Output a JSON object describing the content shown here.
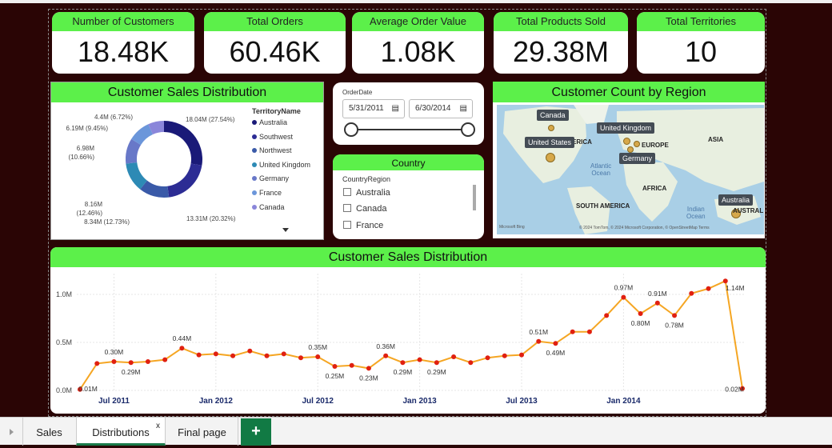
{
  "kpis": [
    {
      "title": "Number of Customers",
      "value": "18.48K"
    },
    {
      "title": "Total Orders",
      "value": "60.46K"
    },
    {
      "title": "Average Order Value",
      "value": "1.08K"
    },
    {
      "title": "Total Products Sold",
      "value": "29.38M"
    },
    {
      "title": "Total Territories",
      "value": "10"
    }
  ],
  "donut": {
    "title": "Customer Sales Distribution",
    "legend_title": "TerritoryName",
    "slices": [
      {
        "name": "Australia",
        "value": 18.04,
        "label": "18.04M (27.54%)",
        "color": "#1a1a78"
      },
      {
        "name": "Southwest",
        "value": 13.31,
        "label": "13.31M (20.32%)",
        "color": "#2c2c94"
      },
      {
        "name": "Northwest",
        "value": 8.34,
        "label": "8.34M (12.73%)",
        "color": "#3a5aa8"
      },
      {
        "name": "United Kingdom",
        "value": 8.16,
        "label": "8.16M\n(12.46%)",
        "color": "#2d8ab5"
      },
      {
        "name": "Germany",
        "value": 6.98,
        "label": "6.98M\n(10.66%)",
        "color": "#6878c8"
      },
      {
        "name": "France",
        "value": 6.19,
        "label": "6.19M (9.45%)",
        "color": "#6b96da"
      },
      {
        "name": "Canada",
        "value": 4.4,
        "label": "4.4M (6.72%)",
        "color": "#8a86da"
      }
    ]
  },
  "date_slicer": {
    "label": "OrderDate",
    "start": "5/31/2011",
    "end": "6/30/2014"
  },
  "country_slicer": {
    "title": "Country",
    "field": "CountryRegion",
    "options": [
      "Australia",
      "Canada",
      "France"
    ]
  },
  "map": {
    "title": "Customer Count by Region",
    "tags": [
      "Canada",
      "United Kingdom",
      "United States",
      "Germany",
      "Australia"
    ],
    "regions": [
      "ERICA",
      "EUROPE",
      "ASIA",
      "AFRICA",
      "SOUTH AMERICA",
      "AUSTRAL"
    ],
    "oceans": [
      "Atlantic\nOcean",
      "Indian\nOcean"
    ],
    "attribution": "© 2024 TomTom, © 2024 Microsoft Corporation, © OpenStreetMap  Terms",
    "logo": "Microsoft Bing"
  },
  "chart_data": {
    "type": "line",
    "title": "Customer Sales Distribution",
    "series": [
      {
        "name": "",
        "values": [
          0.01,
          0.28,
          0.3,
          0.29,
          0.3,
          0.32,
          0.44,
          0.37,
          0.38,
          0.36,
          0.41,
          0.36,
          0.38,
          0.34,
          0.35,
          0.25,
          0.26,
          0.23,
          0.36,
          0.29,
          0.32,
          0.29,
          0.35,
          0.29,
          0.34,
          0.36,
          0.37,
          0.51,
          0.49,
          0.61,
          0.61,
          0.78,
          0.97,
          0.8,
          0.91,
          0.78,
          1.01,
          1.06,
          1.14,
          0.02
        ]
      }
    ],
    "x_ticks": [
      "Jul 2011",
      "Jan 2012",
      "Jul 2012",
      "Jan 2013",
      "Jul 2013",
      "Jan 2014"
    ],
    "y_ticks": [
      "0.0M",
      "0.5M",
      "1.0M"
    ],
    "ylim": [
      0,
      1.2
    ],
    "data_labels": [
      {
        "i": 0,
        "text": "0.01M"
      },
      {
        "i": 2,
        "text": "0.30M"
      },
      {
        "i": 3,
        "text": "0.29M"
      },
      {
        "i": 6,
        "text": "0.44M"
      },
      {
        "i": 14,
        "text": "0.35M"
      },
      {
        "i": 15,
        "text": "0.25M"
      },
      {
        "i": 17,
        "text": "0.23M"
      },
      {
        "i": 18,
        "text": "0.36M"
      },
      {
        "i": 19,
        "text": "0.29M"
      },
      {
        "i": 21,
        "text": "0.29M"
      },
      {
        "i": 27,
        "text": "0.51M"
      },
      {
        "i": 28,
        "text": "0.49M"
      },
      {
        "i": 32,
        "text": "0.97M"
      },
      {
        "i": 33,
        "text": "0.80M"
      },
      {
        "i": 34,
        "text": "0.91M"
      },
      {
        "i": 35,
        "text": "0.78M"
      },
      {
        "i": 38,
        "text": "1.14M"
      },
      {
        "i": 39,
        "text": "0.02M"
      }
    ],
    "line_color": "#f5a623",
    "point_color": "#e02010"
  },
  "tabs": [
    {
      "label": "Sales"
    },
    {
      "label": "Distributions",
      "close": "x"
    },
    {
      "label": "Final page"
    }
  ],
  "add_tab": "+"
}
